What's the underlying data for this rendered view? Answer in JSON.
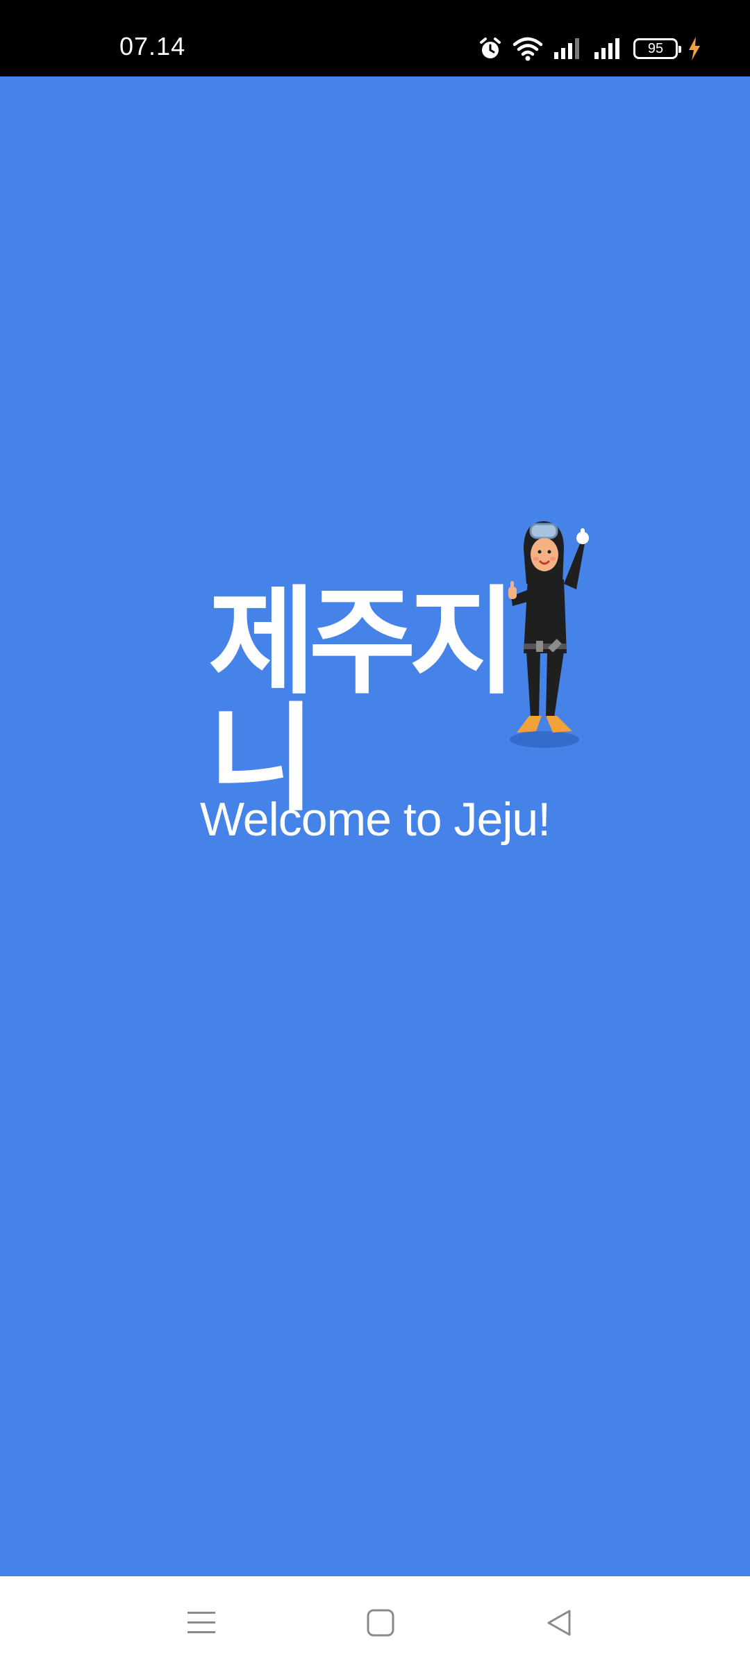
{
  "status_bar": {
    "time": "07.14",
    "battery_level": "95",
    "icons": [
      "alarm-icon",
      "wifi-icon",
      "signal-icon",
      "signal-icon",
      "battery-icon",
      "charging-icon"
    ]
  },
  "splash": {
    "logo_text": "제주지니",
    "welcome_text": "Welcome to Jeju!",
    "background_color": "#4583e8"
  },
  "nav_bar": {
    "buttons": [
      "menu-icon",
      "home-icon",
      "back-icon"
    ]
  }
}
